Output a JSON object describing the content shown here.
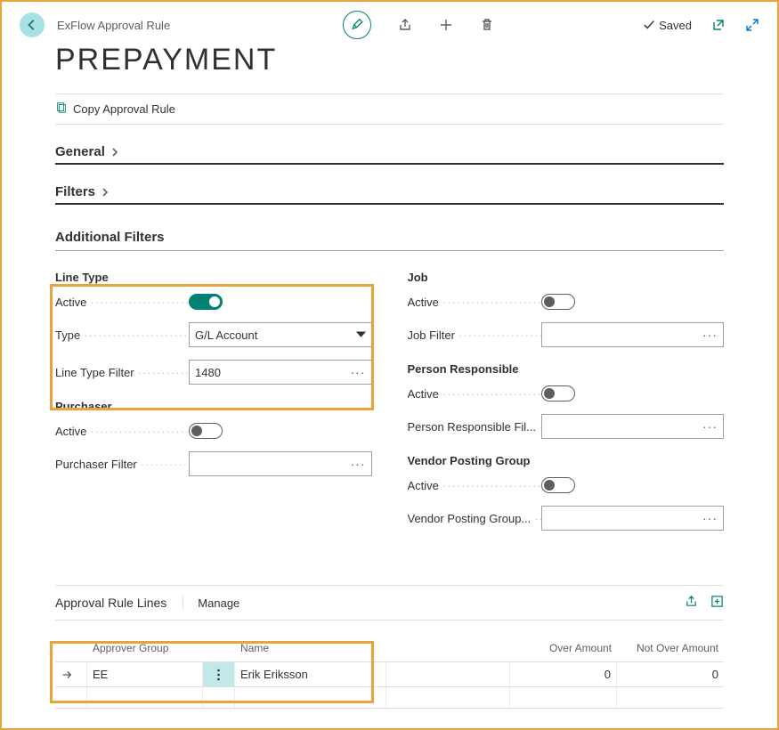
{
  "breadcrumb": "ExFlow Approval Rule",
  "page_title": "PREPAYMENT",
  "saved_label": "Saved",
  "actions": {
    "copy": "Copy Approval Rule"
  },
  "sections": {
    "general": "General",
    "filters": "Filters",
    "additional": "Additional Filters"
  },
  "line_type": {
    "group": "Line Type",
    "active_label": "Active",
    "type_label": "Type",
    "type_value": "G/L Account",
    "filter_label": "Line Type Filter",
    "filter_value": "1480"
  },
  "purchaser": {
    "group": "Purchaser",
    "active_label": "Active",
    "filter_label": "Purchaser Filter",
    "filter_value": ""
  },
  "job": {
    "group": "Job",
    "active_label": "Active",
    "filter_label": "Job Filter",
    "filter_value": ""
  },
  "person": {
    "group": "Person Responsible",
    "active_label": "Active",
    "filter_label": "Person Responsible Fil...",
    "filter_value": ""
  },
  "vendor": {
    "group": "Vendor Posting Group",
    "active_label": "Active",
    "filter_label": "Vendor Posting Group...",
    "filter_value": ""
  },
  "lines": {
    "title": "Approval Rule Lines",
    "manage": "Manage",
    "headers": {
      "approver_group": "Approver Group",
      "name": "Name",
      "over": "Over Amount",
      "not_over": "Not Over Amount"
    },
    "rows": [
      {
        "approver_group": "EE",
        "name": "Erik Eriksson",
        "over": "0",
        "not_over": "0"
      }
    ]
  }
}
